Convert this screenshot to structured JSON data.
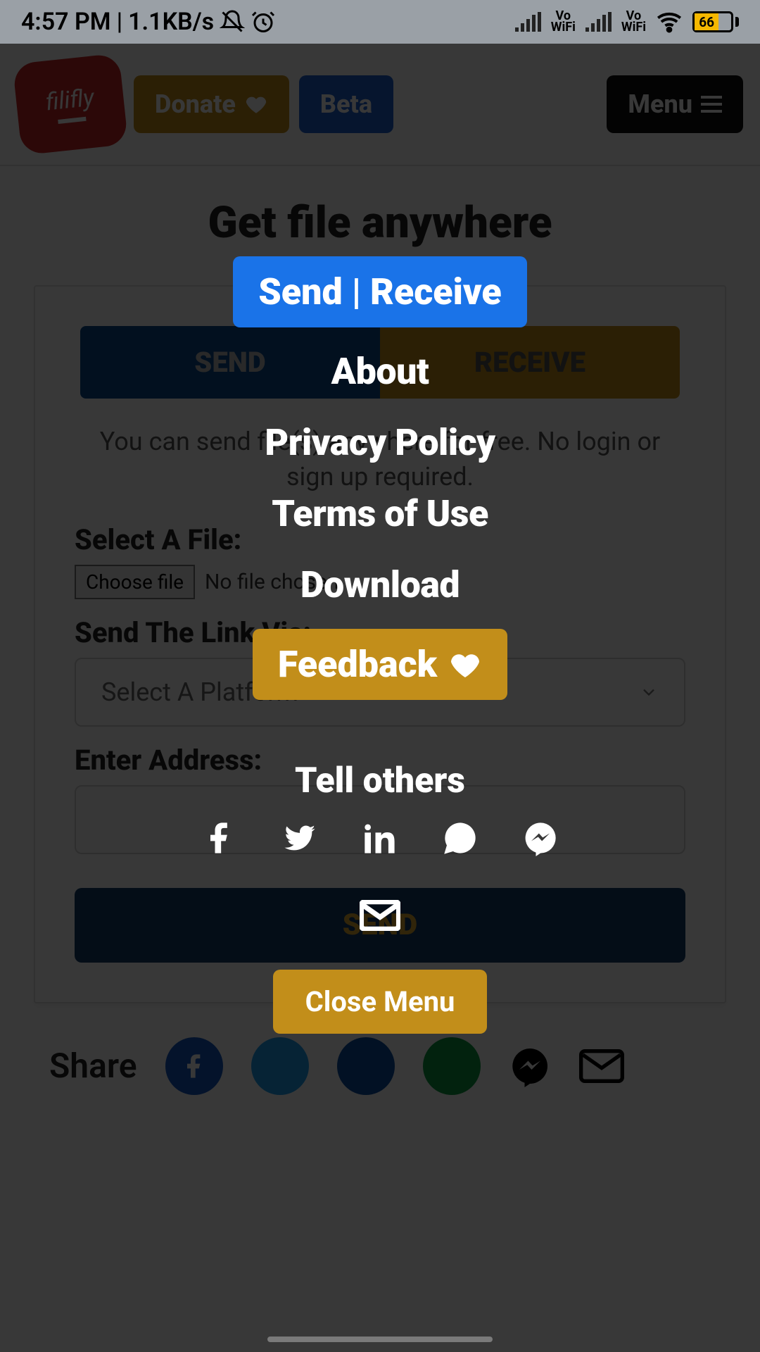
{
  "status": {
    "time": "4:57 PM",
    "net_speed": "1.1KB/s",
    "battery_pct": "66",
    "vo": "Vo",
    "wifi": "WiFi"
  },
  "topbar": {
    "logo_text": "filifly",
    "donate": "Donate",
    "beta": "Beta",
    "menu": "Menu"
  },
  "hero": "Get file anywhere",
  "seg": {
    "send": "SEND",
    "receive": "RECEIVE"
  },
  "card": {
    "sub": "You can send file(s) anywhere for free. No login or sign up required.",
    "select_file": "Select A File:",
    "choose_file": "Choose file",
    "no_file": "No file chosen",
    "link_via": "Send The Link Via:",
    "select_platform": "Select A Platform",
    "enter_addr": "Enter Address:",
    "send_btn": "SEND"
  },
  "share_label": "Share",
  "menu": {
    "send_receive": "Send | Receive",
    "about": "About",
    "privacy": "Privacy Policy",
    "terms": "Terms of Use",
    "download": "Download",
    "feedback": "Feedback",
    "tell": "Tell others",
    "close": "Close Menu"
  }
}
